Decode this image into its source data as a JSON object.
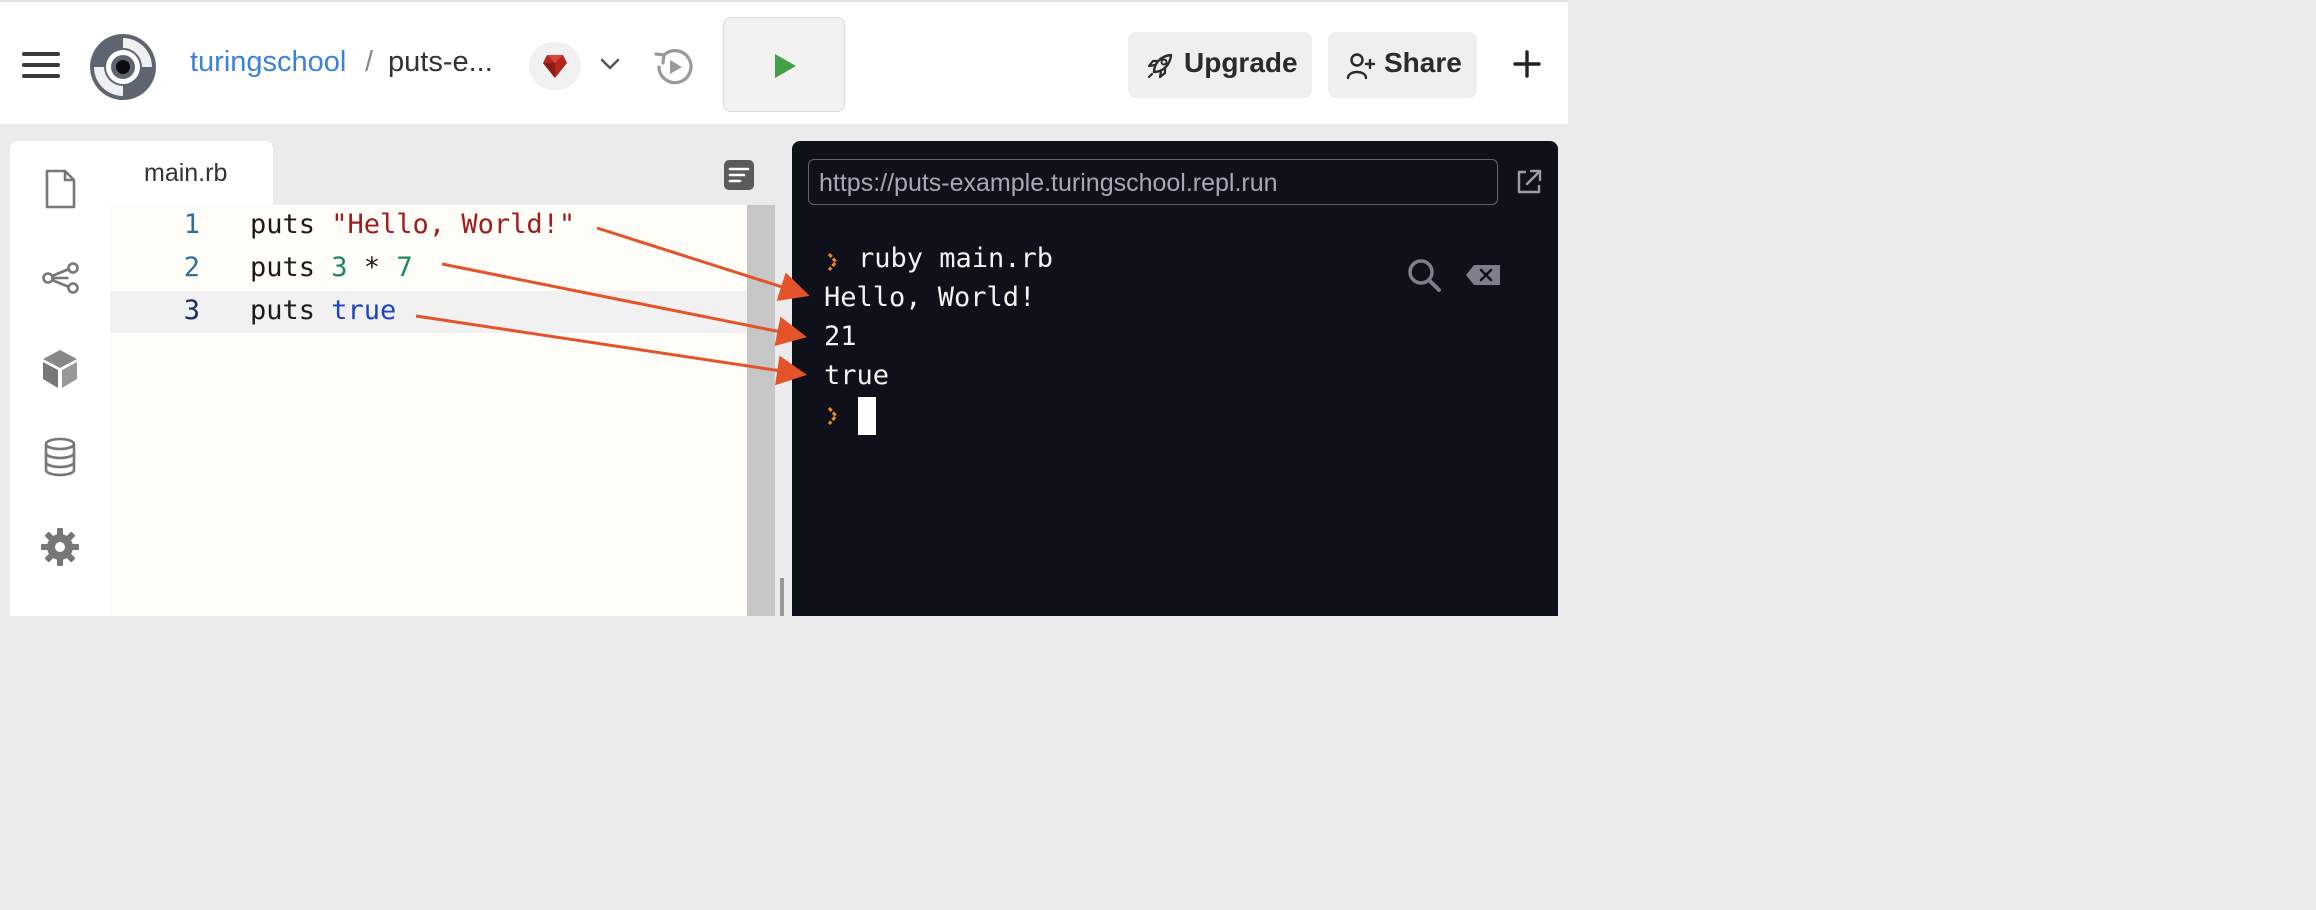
{
  "header": {
    "owner": "turingschool",
    "separator": "/",
    "repl_name": "puts-e...",
    "upgrade_label": "Upgrade",
    "share_label": "Share"
  },
  "editor": {
    "tab_label": "main.rb",
    "lines": [
      {
        "number": "1",
        "parts": [
          {
            "t": "puts ",
            "c": "plain"
          },
          {
            "t": "\"Hello, World!\"",
            "c": "str"
          }
        ]
      },
      {
        "number": "2",
        "parts": [
          {
            "t": "puts ",
            "c": "plain"
          },
          {
            "t": "3",
            "c": "num"
          },
          {
            "t": " * ",
            "c": "plain"
          },
          {
            "t": "7",
            "c": "num"
          }
        ]
      },
      {
        "number": "3",
        "parts": [
          {
            "t": "puts ",
            "c": "plain"
          },
          {
            "t": "true",
            "c": "kw"
          }
        ]
      }
    ],
    "active_line": 3
  },
  "console": {
    "url": "https://puts-example.turingschool.repl.run",
    "command": "ruby main.rb",
    "output": [
      "Hello, World!",
      "21",
      "true"
    ]
  },
  "colors": {
    "brand_blue": "#3c82d9",
    "run_green": "#43a047",
    "annotation_arrow": "#e4532a",
    "console_bg": "#0f111a",
    "prompt_orange": "#f08a24"
  },
  "icons": {
    "menu": "hamburger-menu-icon",
    "logo": "replit-logo",
    "language": "ruby-gem-icon",
    "history": "history-play-icon",
    "run": "play-icon",
    "upgrade": "rocket-icon",
    "share": "add-user-icon",
    "new": "plus-icon",
    "files": "file-icon",
    "version_control": "share-nodes-icon",
    "packages": "cube-icon",
    "database": "database-icon",
    "settings": "gear-icon"
  }
}
